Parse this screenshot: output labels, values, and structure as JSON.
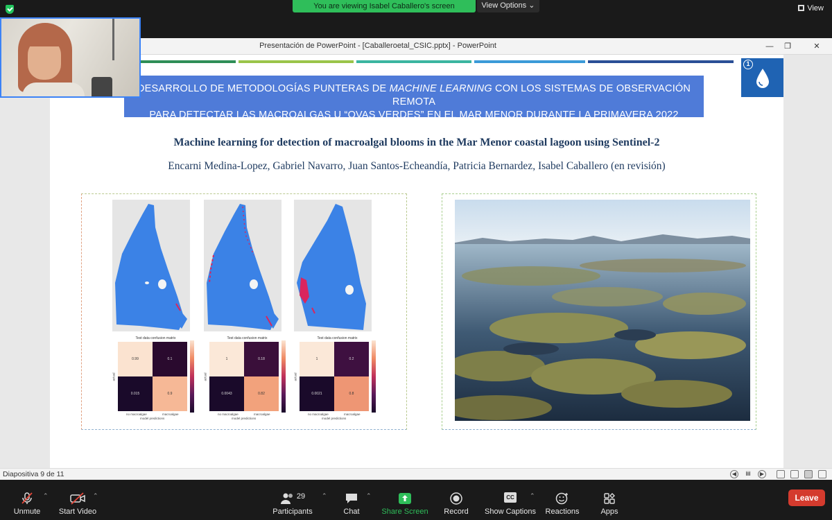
{
  "zoom": {
    "banner": "You are viewing Isabel Caballero's screen",
    "view_options": "View Options",
    "view": "View",
    "toolbar": {
      "unmute": "Unmute",
      "start_video": "Start Video",
      "participants_count": "29",
      "participants": "Participants",
      "chat": "Chat",
      "share_screen": "Share Screen",
      "record": "Record",
      "show_captions": "Show Captions",
      "captions_badge": "CC",
      "reactions": "Reactions",
      "apps": "Apps",
      "leave": "Leave"
    },
    "accent_share": "#2fbe5a",
    "leave_color": "#d43b2e"
  },
  "powerpoint": {
    "window_title": "Presentación de PowerPoint - [Caballeroetal_CSIC.pptx] - PowerPoint",
    "status": "Diapositiva 9 de 11"
  },
  "slide": {
    "title_line1_pre": "DESARROLLO DE METODOLOGÍAS PUNTERAS DE ",
    "title_line1_em": "MACHINE LEARNING",
    "title_line1_post": " CON LOS SISTEMAS DE OBSERVACIÓN REMOTA",
    "title_line2": "PARA DETECTAR LAS MACROALGAS U “OVAS VERDES” EN EL MAR MENOR DURANTE LA PRIMAVERA 2022",
    "logo_number": "1",
    "paper_title": "Machine learning for detection of macroalgal blooms in the Mar Menor coastal lagoon using Sentinel-2",
    "authors": "Encarni Medina-Lopez, Gabriel Navarro, Juan Santos-Echeandía, Patricia Bernardez, Isabel Caballero (en revisión)",
    "confusion_matrices": [
      {
        "title": "Test data confusion matrix",
        "tl": "0.99",
        "tr": "0.1",
        "bl": "0.015",
        "br": "0.9",
        "x_label": "model predictions",
        "y_label": "actual",
        "x_ticks": [
          "no macroalgae",
          "macroalgae"
        ],
        "y_ticks": [
          "no macroalgae",
          "macroalgae"
        ]
      },
      {
        "title": "Test data confusion matrix",
        "tl": "1",
        "tr": "0.18",
        "bl": "0.0043",
        "br": "0.82",
        "x_label": "model predictions",
        "y_label": "actual",
        "x_ticks": [
          "no macroalgae",
          "macroalgae"
        ],
        "y_ticks": [
          "no macroalgae",
          "macroalgae"
        ]
      },
      {
        "title": "Test data confusion matrix",
        "tl": "1",
        "tr": "0.2",
        "bl": "0.0021",
        "br": "0.8",
        "x_label": "model predictions",
        "y_label": "actual",
        "x_ticks": [
          "no macroalgae",
          "macroalgae"
        ],
        "y_ticks": [
          "no macroalgae",
          "macroalgae"
        ]
      }
    ],
    "colorbar_ticks": [
      "0.8",
      "0.6",
      "0.4",
      "0.2"
    ]
  }
}
